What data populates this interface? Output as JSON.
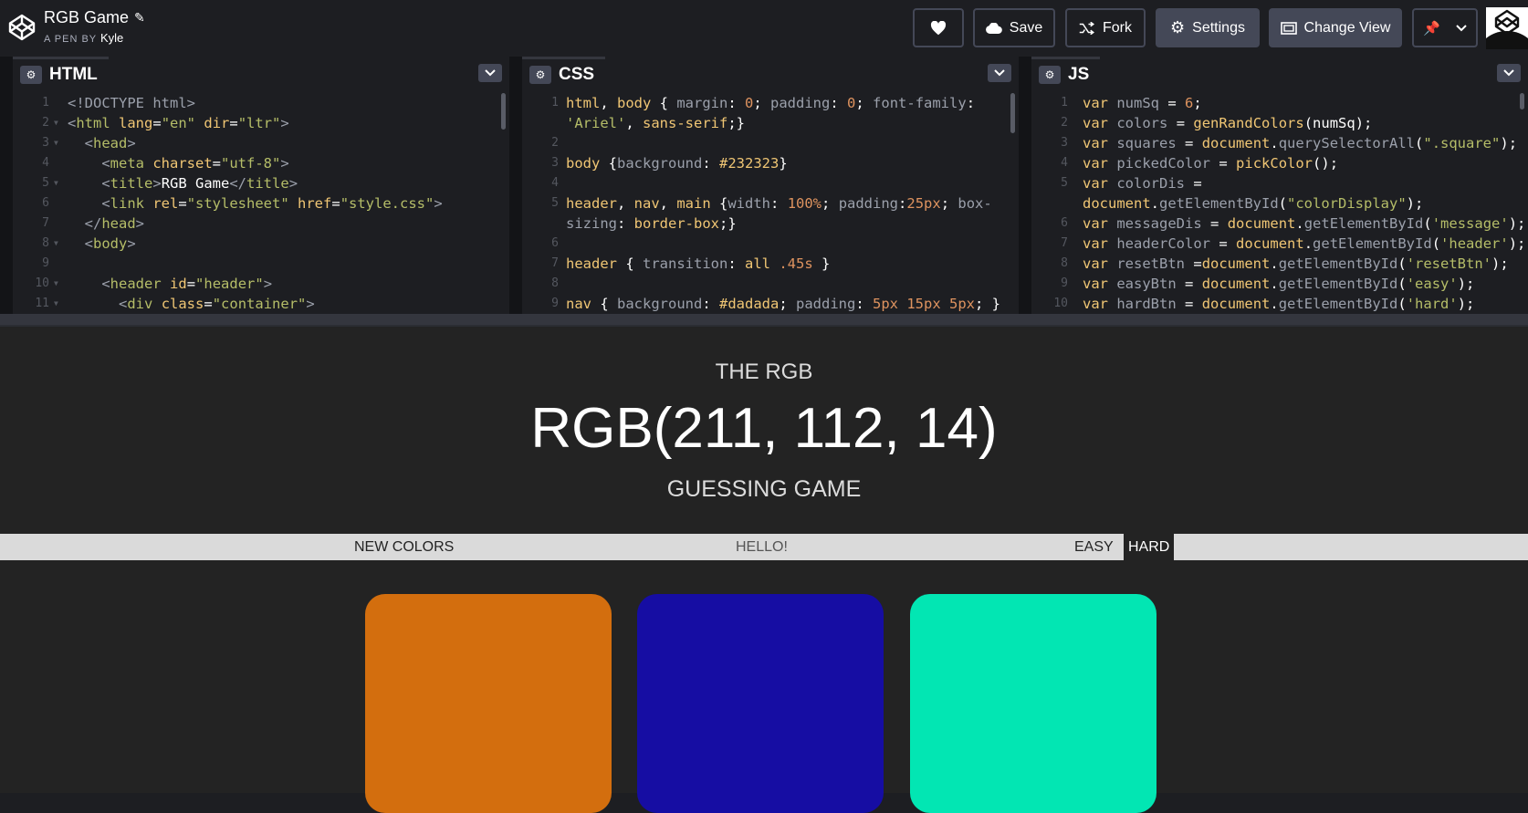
{
  "topbar": {
    "pen_title": "RGB Game",
    "pen_by": "A PEN BY",
    "author": "Kyle",
    "buttons": {
      "save": "Save",
      "fork": "Fork",
      "settings": "Settings",
      "change_view": "Change View"
    }
  },
  "editors": {
    "html": {
      "name": "HTML"
    },
    "css": {
      "name": "CSS"
    },
    "js": {
      "name": "JS"
    }
  },
  "preview": {
    "header": {
      "line1": "THE RGB",
      "color_display": "RGB(211, 112, 14)",
      "line3": "GUESSING GAME"
    },
    "nav": {
      "new_colors": "NEW COLORS",
      "message": "HELLO!",
      "easy": "EASY",
      "hard": "HARD"
    },
    "squares": [
      {
        "color": "#d36e0e"
      },
      {
        "color": "#160da3"
      },
      {
        "color": "#02e6b3"
      }
    ]
  },
  "colors": {
    "app_bg": "#1d1e22",
    "button_fill": "#444857",
    "preview_bg": "#232323",
    "nav_bg": "#dadada"
  }
}
